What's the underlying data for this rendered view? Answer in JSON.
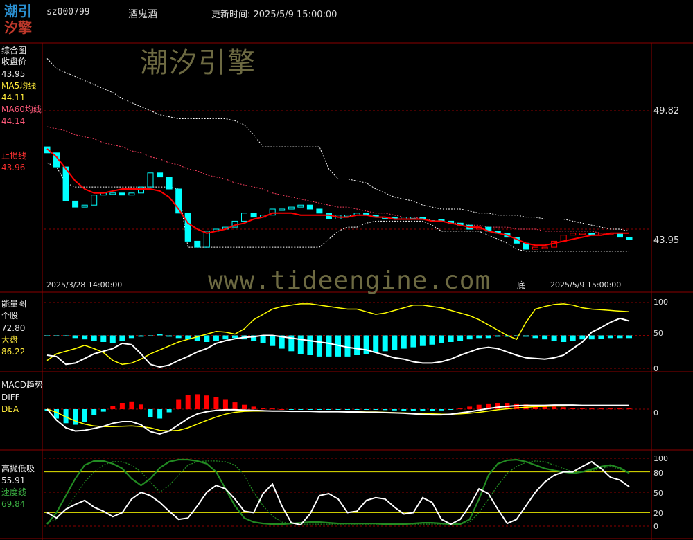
{
  "header": {
    "logo_line1": "潮引",
    "logo_line2": "汐擎",
    "code": "sz000799",
    "name": "酒鬼酒",
    "update_label": "更新时间: 2025/5/9 15:00:00"
  },
  "watermarks": {
    "brand": "潮汐引擎",
    "site": "www.tideengine.com"
  },
  "colors": {
    "bg": "#000000",
    "frame": "#8b0000",
    "ma5": "#ff0000",
    "up": "#ff0000",
    "down": "#00ffff",
    "yellow": "#ffff00",
    "green": "#228b22"
  },
  "chart_data": [
    {
      "type": "line",
      "panel": "综合图",
      "labels": {
        "title": "综合图",
        "close_label": "收盘价",
        "close_value": "43.95",
        "ma5_label": "MA5均线",
        "ma5_value": "44.11",
        "ma60_label": "MA60均线",
        "ma60_value": "44.14",
        "stop_label": "止损线",
        "stop_value": "43.96"
      },
      "right_axis": {
        "ref_high": "49.82",
        "ref_last": "43.95"
      },
      "x_start": "2025/3/28 14:00:00",
      "x_end": "2025/5/9 15:00:00",
      "bottom_marker": "底",
      "ylim": [
        41.5,
        53.5
      ],
      "close": [
        48.3,
        47.6,
        45.9,
        45.6,
        45.7,
        46.2,
        46.3,
        46.3,
        46.2,
        46.3,
        46.6,
        47.3,
        47.1,
        46.5,
        45.3,
        43.9,
        43.6,
        44.4,
        44.5,
        44.6,
        44.9,
        45.3,
        45.1,
        45.2,
        45.5,
        45.5,
        45.6,
        45.7,
        45.5,
        45.3,
        45.0,
        45.2,
        45.2,
        45.3,
        45.2,
        45.1,
        45.1,
        45.0,
        45.1,
        45.1,
        45.0,
        45.0,
        44.9,
        44.8,
        44.7,
        44.5,
        44.6,
        44.4,
        44.3,
        44.1,
        43.8,
        43.5,
        43.6,
        43.6,
        43.9,
        44.2,
        44.3,
        44.3,
        44.2,
        44.3,
        44.3,
        44.1,
        44.0
      ],
      "ma_red": [
        48.5,
        48.1,
        47.5,
        46.9,
        46.5,
        46.3,
        46.3,
        46.4,
        46.5,
        46.5,
        46.5,
        46.5,
        46.4,
        46.1,
        45.5,
        44.8,
        44.5,
        44.3,
        44.4,
        44.5,
        44.7,
        44.8,
        45.0,
        45.1,
        45.3,
        45.3,
        45.3,
        45.2,
        45.2,
        45.2,
        45.2,
        45.1,
        45.1,
        45.2,
        45.2,
        45.1,
        45.1,
        45.0,
        45.0,
        45.0,
        45.0,
        44.9,
        44.9,
        44.8,
        44.7,
        44.6,
        44.6,
        44.4,
        44.3,
        44.2,
        44.0,
        43.8,
        43.7,
        43.7,
        43.8,
        43.9,
        44.0,
        44.1,
        44.2,
        44.2,
        44.3,
        44.3,
        44.3
      ],
      "upper_band": [
        53.0,
        52.5,
        52.3,
        52.1,
        51.9,
        51.7,
        51.5,
        51.3,
        51.0,
        50.8,
        50.6,
        50.4,
        50.2,
        50.1,
        50.0,
        50.0,
        50.0,
        50.0,
        50.0,
        50.0,
        49.9,
        49.7,
        49.2,
        48.6,
        48.6,
        48.6,
        48.6,
        48.6,
        48.6,
        48.6,
        47.5,
        47.0,
        47.0,
        46.9,
        46.8,
        46.5,
        46.3,
        46.1,
        46.0,
        45.9,
        45.7,
        45.6,
        45.5,
        45.5,
        45.5,
        45.4,
        45.3,
        45.3,
        45.2,
        45.2,
        45.2,
        45.1,
        45.1,
        45.0,
        45.0,
        45.0,
        44.9,
        44.8,
        44.7,
        44.6,
        44.5,
        44.5,
        44.4
      ],
      "lower_band": [
        47.8,
        47.6,
        46.8,
        46.6,
        46.6,
        46.6,
        46.6,
        46.6,
        46.6,
        46.6,
        46.6,
        46.6,
        46.6,
        46.6,
        46.5,
        43.6,
        43.6,
        43.6,
        43.6,
        43.6,
        43.6,
        43.6,
        43.6,
        43.6,
        43.6,
        43.6,
        43.6,
        43.6,
        43.6,
        43.6,
        44.0,
        44.4,
        44.6,
        44.6,
        44.8,
        44.9,
        44.9,
        44.9,
        44.9,
        44.9,
        44.9,
        44.7,
        44.4,
        44.4,
        44.4,
        44.4,
        44.4,
        44.2,
        44.0,
        43.8,
        43.5,
        43.4,
        43.4,
        43.4,
        43.4,
        43.4,
        43.4,
        43.4,
        43.4,
        43.4,
        43.4,
        43.4,
        43.4
      ],
      "ma_slow": [
        49.6,
        49.5,
        49.4,
        49.2,
        49.1,
        49.0,
        48.8,
        48.7,
        48.6,
        48.4,
        48.3,
        48.1,
        48.0,
        47.8,
        47.7,
        47.5,
        47.4,
        47.2,
        47.1,
        47.0,
        46.8,
        46.7,
        46.6,
        46.5,
        46.3,
        46.2,
        46.1,
        46.0,
        45.9,
        45.8,
        45.7,
        45.6,
        45.6,
        45.5,
        45.4,
        45.3,
        45.3,
        45.2,
        45.1,
        45.1,
        45.0,
        44.9,
        44.9,
        44.8,
        44.8,
        44.7,
        44.7,
        44.6,
        44.6,
        44.6,
        44.5,
        44.5,
        44.5,
        44.4,
        44.4,
        44.4,
        44.4,
        44.4,
        44.4,
        44.3,
        44.3,
        44.3,
        44.3
      ]
    },
    {
      "type": "line",
      "panel": "能量图",
      "labels": {
        "title": "能量图",
        "stock_label": "个股",
        "stock_value": "72.80",
        "market_label": "大盘",
        "market_value": "86.22"
      },
      "yticks": [
        "100",
        "50",
        "0"
      ],
      "ylim": [
        0,
        100
      ],
      "stock": [
        20,
        18,
        6,
        8,
        15,
        22,
        26,
        30,
        38,
        36,
        22,
        6,
        2,
        5,
        12,
        18,
        25,
        30,
        38,
        42,
        45,
        47,
        48,
        50,
        50,
        48,
        46,
        44,
        42,
        40,
        38,
        35,
        32,
        30,
        28,
        24,
        20,
        16,
        14,
        10,
        8,
        8,
        10,
        14,
        20,
        25,
        30,
        32,
        30,
        25,
        20,
        16,
        15,
        14,
        16,
        20,
        30,
        40,
        55,
        62,
        70,
        76,
        72
      ],
      "market": [
        12,
        22,
        26,
        30,
        35,
        30,
        24,
        12,
        6,
        8,
        14,
        22,
        28,
        34,
        40,
        44,
        48,
        52,
        56,
        55,
        52,
        60,
        74,
        82,
        90,
        94,
        96,
        98,
        98,
        96,
        94,
        92,
        90,
        90,
        86,
        82,
        84,
        88,
        92,
        96,
        96,
        94,
        92,
        88,
        84,
        80,
        74,
        66,
        58,
        50,
        44,
        70,
        90,
        94,
        97,
        98,
        96,
        92,
        90,
        89,
        88,
        87,
        86
      ],
      "bars": [
        0,
        0,
        0,
        -4,
        -6,
        -8,
        -10,
        -12,
        -8,
        -4,
        -2,
        0,
        2,
        -2,
        -4,
        -6,
        -8,
        -10,
        -8,
        -6,
        -4,
        -6,
        -8,
        -12,
        -16,
        -20,
        -24,
        -28,
        -30,
        -32,
        -32,
        -32,
        -32,
        -30,
        -28,
        -26,
        -24,
        -22,
        -20,
        -18,
        -16,
        -14,
        -12,
        -10,
        -8,
        -6,
        -4,
        -4,
        -2,
        -2,
        -1,
        -2,
        -4,
        -6,
        -8,
        -10,
        -8,
        -6,
        -6,
        -5,
        -4,
        -4,
        -4
      ]
    },
    {
      "type": "line",
      "panel": "MACD趋势",
      "labels": {
        "title": "MACD趋势",
        "diff_label": "DIFF",
        "dea_label": "DEA"
      },
      "yticks": [
        "0"
      ],
      "ylim": [
        -1.2,
        0.8
      ],
      "diff": [
        -0.0,
        -0.35,
        -0.6,
        -0.7,
        -0.68,
        -0.62,
        -0.55,
        -0.45,
        -0.4,
        -0.4,
        -0.5,
        -0.72,
        -0.8,
        -0.7,
        -0.5,
        -0.3,
        -0.15,
        -0.08,
        -0.04,
        -0.02,
        -0.02,
        -0.03,
        -0.04,
        -0.05,
        -0.06,
        -0.06,
        -0.07,
        -0.07,
        -0.07,
        -0.08,
        -0.08,
        -0.08,
        -0.09,
        -0.09,
        -0.1,
        -0.1,
        -0.11,
        -0.12,
        -0.13,
        -0.15,
        -0.17,
        -0.18,
        -0.18,
        -0.16,
        -0.12,
        -0.08,
        -0.03,
        0.02,
        0.06,
        0.09,
        0.11,
        0.12,
        0.12,
        0.12,
        0.13,
        0.13,
        0.13,
        0.12,
        0.12,
        0.12,
        0.12,
        0.12,
        0.12
      ],
      "dea": [
        0.0,
        -0.1,
        -0.25,
        -0.38,
        -0.48,
        -0.54,
        -0.56,
        -0.56,
        -0.55,
        -0.54,
        -0.56,
        -0.6,
        -0.68,
        -0.7,
        -0.68,
        -0.6,
        -0.48,
        -0.36,
        -0.25,
        -0.16,
        -0.1,
        -0.07,
        -0.06,
        -0.06,
        -0.06,
        -0.06,
        -0.06,
        -0.07,
        -0.07,
        -0.07,
        -0.07,
        -0.08,
        -0.08,
        -0.08,
        -0.09,
        -0.09,
        -0.1,
        -0.11,
        -0.12,
        -0.13,
        -0.14,
        -0.15,
        -0.16,
        -0.16,
        -0.15,
        -0.13,
        -0.1,
        -0.06,
        -0.02,
        0.01,
        0.04,
        0.06,
        0.08,
        0.09,
        0.1,
        0.1,
        0.11,
        0.11,
        0.11,
        0.11,
        0.11,
        0.11,
        0.11
      ],
      "hist": [
        -0.05,
        -0.3,
        -0.45,
        -0.5,
        -0.4,
        -0.2,
        -0.08,
        0.1,
        0.2,
        0.25,
        0.15,
        -0.25,
        -0.3,
        -0.1,
        0.3,
        0.45,
        0.48,
        0.44,
        0.38,
        0.3,
        0.22,
        0.14,
        0.08,
        0.04,
        0.02,
        0.0,
        -0.02,
        -0.02,
        -0.02,
        -0.02,
        -0.02,
        -0.01,
        -0.01,
        -0.01,
        -0.02,
        -0.02,
        -0.03,
        -0.04,
        -0.05,
        -0.06,
        -0.06,
        -0.05,
        -0.04,
        -0.02,
        0.03,
        0.08,
        0.14,
        0.18,
        0.2,
        0.2,
        0.18,
        0.15,
        0.12,
        0.1,
        0.08,
        0.06,
        0.04,
        0.03,
        0.02,
        0.02,
        0.02,
        0.02,
        0.02
      ]
    },
    {
      "type": "line",
      "panel": "高抛低吸",
      "labels": {
        "title": "高抛低吸",
        "value_a": "55.91",
        "speed_label": "速度线",
        "speed_value": "69.84"
      },
      "yticks": [
        "100",
        "80",
        "50",
        "20",
        "0"
      ],
      "ylim": [
        0,
        100
      ],
      "white": [
        20,
        12,
        25,
        32,
        38,
        28,
        22,
        14,
        20,
        40,
        50,
        45,
        35,
        22,
        10,
        12,
        30,
        50,
        60,
        55,
        40,
        22,
        20,
        48,
        62,
        30,
        5,
        2,
        18,
        45,
        48,
        40,
        20,
        22,
        38,
        42,
        40,
        28,
        18,
        20,
        42,
        35,
        10,
        3,
        10,
        30,
        55,
        48,
        25,
        4,
        10,
        30,
        50,
        65,
        75,
        80,
        80,
        88,
        95,
        85,
        72,
        68,
        58
      ],
      "green_dotted": [
        5,
        10,
        25,
        45,
        65,
        80,
        90,
        95,
        95,
        90,
        80,
        65,
        50,
        60,
        75,
        90,
        95,
        96,
        96,
        95,
        90,
        75,
        50,
        30,
        15,
        6,
        4,
        3,
        3,
        3,
        3,
        3,
        3,
        3,
        3,
        3,
        3,
        3,
        3,
        3,
        3,
        3,
        3,
        3,
        3,
        6,
        20,
        40,
        60,
        78,
        88,
        94,
        96,
        95,
        90,
        85,
        80,
        80,
        82,
        85,
        88,
        84,
        78
      ],
      "green_solid": [
        3,
        20,
        45,
        70,
        90,
        96,
        96,
        92,
        85,
        70,
        60,
        70,
        86,
        95,
        98,
        98,
        96,
        92,
        80,
        55,
        30,
        12,
        6,
        4,
        3,
        3,
        4,
        5,
        6,
        6,
        5,
        4,
        4,
        4,
        4,
        4,
        3,
        3,
        3,
        4,
        5,
        5,
        4,
        3,
        3,
        10,
        40,
        75,
        92,
        97,
        98,
        95,
        90,
        85,
        82,
        80,
        78,
        80,
        84,
        88,
        90,
        86,
        78
      ]
    }
  ]
}
